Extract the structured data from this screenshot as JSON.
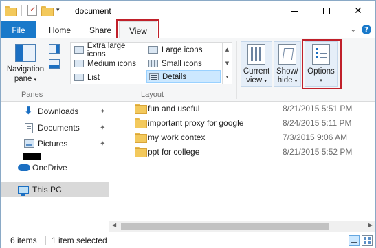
{
  "window": {
    "title": "document"
  },
  "tabs": {
    "file": "File",
    "home": "Home",
    "share": "Share",
    "view": "View"
  },
  "ribbon": {
    "panes": {
      "navigation_pane_line1": "Navigation",
      "navigation_pane_line2": "pane",
      "group_label": "Panes"
    },
    "layout": {
      "group_label": "Layout",
      "items": [
        {
          "label": "Extra large icons"
        },
        {
          "label": "Large icons"
        },
        {
          "label": "Medium icons"
        },
        {
          "label": "Small icons"
        },
        {
          "label": "List"
        },
        {
          "label": "Details",
          "selected": true
        }
      ]
    },
    "current_view": {
      "line1": "Current",
      "line2": "view"
    },
    "show_hide": {
      "line1": "Show/",
      "line2": "hide"
    },
    "options": {
      "label": "Options"
    }
  },
  "nav_pane": {
    "items": [
      {
        "label": "Downloads",
        "icon": "download-arrow-icon",
        "pinned": true
      },
      {
        "label": "Documents",
        "icon": "documents-icon",
        "pinned": true
      },
      {
        "label": "Pictures",
        "icon": "pictures-icon",
        "pinned": true
      },
      {
        "label": "OneDrive",
        "icon": "onedrive-cloud-icon"
      },
      {
        "label": "This PC",
        "icon": "this-pc-icon",
        "selected": true
      }
    ]
  },
  "files": [
    {
      "name": "fun and useful",
      "date": "8/21/2015 5:51 PM"
    },
    {
      "name": "important proxy for google",
      "date": "8/24/2015 5:11 PM"
    },
    {
      "name": "my work contex",
      "date": "7/3/2015 9:06 AM"
    },
    {
      "name": "ppt for college",
      "date": "8/21/2015 5:52 PM"
    }
  ],
  "status": {
    "item_count": "6 items",
    "selection": "1 item selected"
  },
  "colors": {
    "accent": "#1979ca",
    "highlight_box": "#c0202a"
  }
}
